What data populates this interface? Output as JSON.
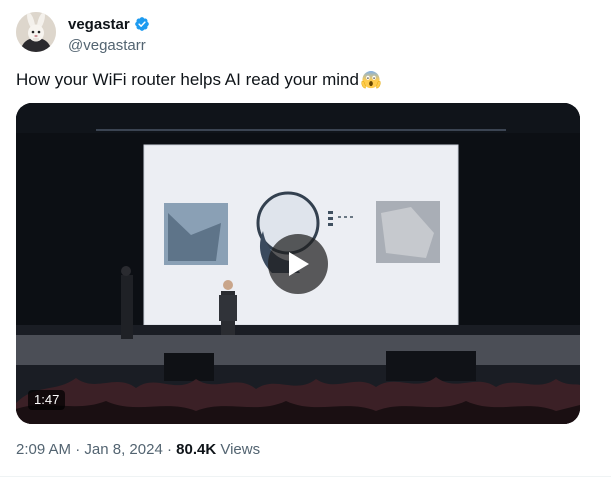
{
  "author": {
    "display_name": "vegastar",
    "handle": "@vegastarr",
    "verified": true,
    "verified_color": "#1d9bf0"
  },
  "tweet": {
    "text": "How your WiFi router helps AI read your mind",
    "emoji": "face-screaming-in-fear"
  },
  "video": {
    "duration": "1:47",
    "play_icon": "play-icon"
  },
  "meta": {
    "time": "2:09 AM",
    "separator": "·",
    "date": "Jan 8, 2024",
    "views_count": "80.4K",
    "views_label": "Views"
  }
}
